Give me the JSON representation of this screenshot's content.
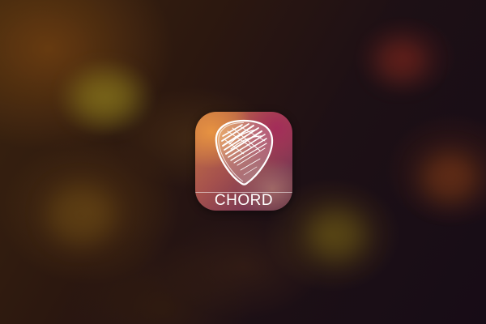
{
  "app": {
    "name": "CHORD",
    "icon": "guitar-pick-icon"
  },
  "colors": {
    "background_dark": "#1a0f14",
    "icon_warm": "#c87a45",
    "icon_magenta": "#7a3a52",
    "label_text": "#ffffff"
  }
}
